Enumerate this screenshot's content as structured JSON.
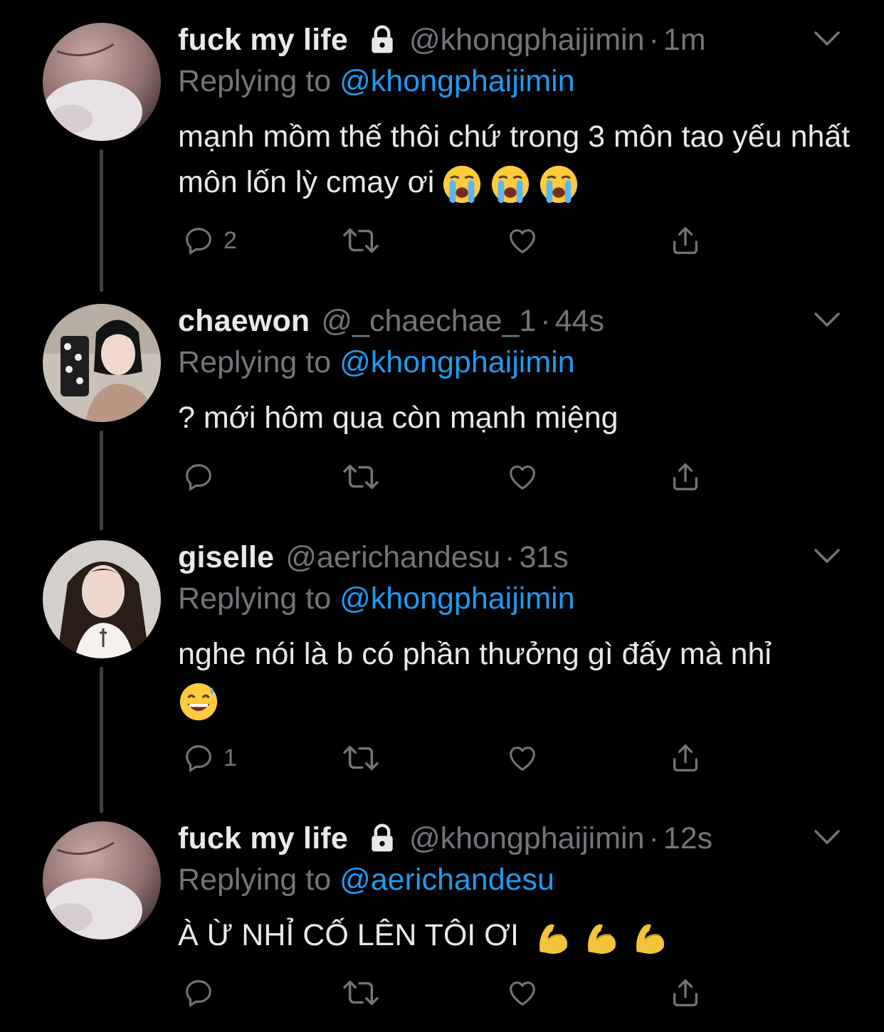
{
  "thread": [
    {
      "name": "fuck my life",
      "protected": true,
      "handle": "@khongphaijimin",
      "separator": "·",
      "time": "1m",
      "replying_prefix": "Replying to",
      "replying_to": "@khongphaijimin",
      "text": "mạnh mồm thế thôi chứ trong 3 môn tao yếu nhất môn lốn lỳ cmay ơi",
      "emojis": [
        "loudly-crying-face",
        "loudly-crying-face",
        "loudly-crying-face"
      ],
      "reply_count": "2"
    },
    {
      "name": "chaewon",
      "protected": false,
      "handle": "@_chaechae_1",
      "separator": "·",
      "time": "44s",
      "replying_prefix": "Replying to",
      "replying_to": "@khongphaijimin",
      "text": "? mới hôm qua còn mạnh miệng",
      "emojis": [],
      "reply_count": ""
    },
    {
      "name": "giselle",
      "protected": false,
      "handle": "@aerichandesu",
      "separator": "·",
      "time": "31s",
      "replying_prefix": "Replying to",
      "replying_to": "@khongphaijimin",
      "text": "nghe nói là b có phần thưởng gì đấy mà nhỉ",
      "emojis": [
        "grinning-face-with-sweat"
      ],
      "reply_count": "1"
    },
    {
      "name": "fuck my life",
      "protected": true,
      "handle": "@khongphaijimin",
      "separator": "·",
      "time": "12s",
      "replying_prefix": "Replying to",
      "replying_to": "@aerichandesu",
      "text": "À Ừ NHỈ CỐ LÊN TÔI ƠI",
      "emojis": [
        "flexed-biceps",
        "flexed-biceps",
        "flexed-biceps"
      ],
      "reply_count": ""
    }
  ],
  "icons": {
    "lock": "lock-icon",
    "menu": "chevron-down-icon",
    "reply": "reply-icon",
    "retweet": "retweet-icon",
    "like": "heart-icon",
    "share": "share-icon"
  },
  "colors": {
    "background": "#000000",
    "name": "#e7e9ea",
    "secondary": "#71767b",
    "mention": "#1d9bf0",
    "thread_line": "#3d4145"
  }
}
